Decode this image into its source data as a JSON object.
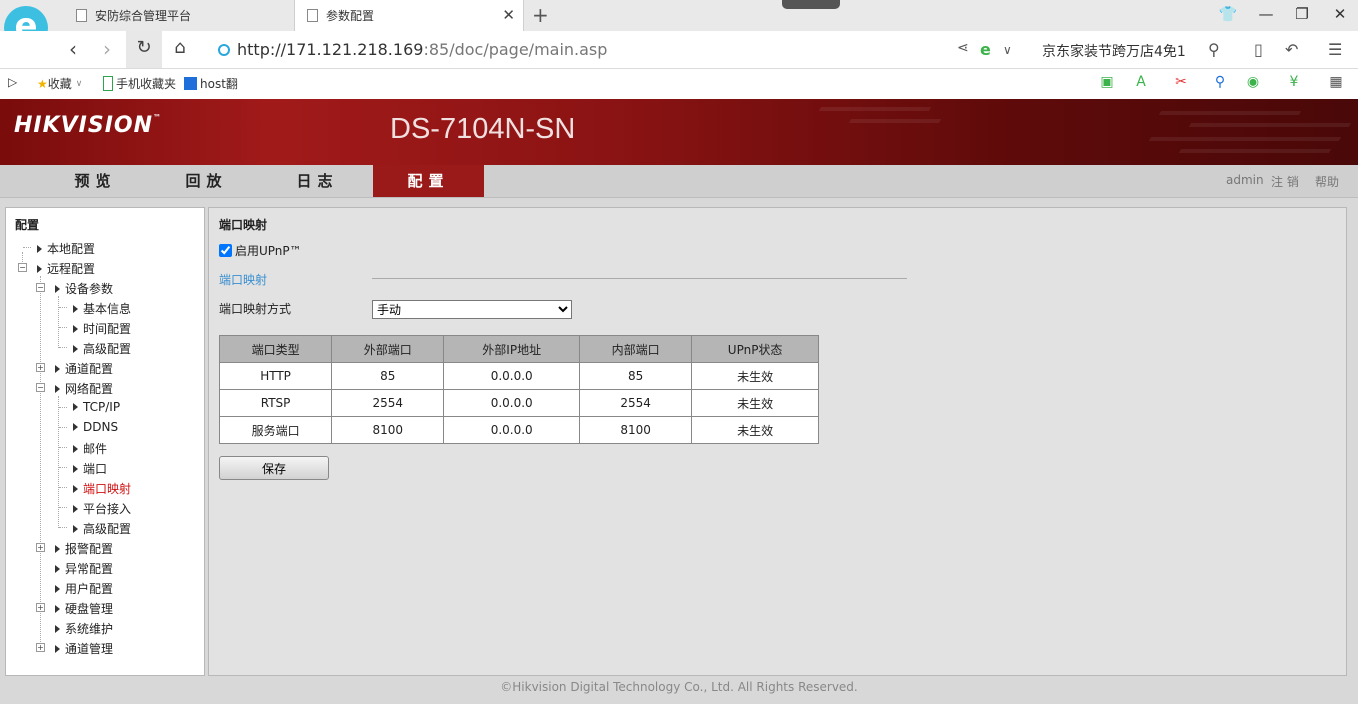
{
  "browser": {
    "tabs": [
      {
        "title": "安防综合管理平台",
        "active": false
      },
      {
        "title": "参数配置",
        "active": true
      }
    ],
    "address": {
      "host": "http://171.121.218.169",
      "rest": ":85/doc/page/main.asp"
    },
    "search_text": "京东家装节跨万店4免1",
    "bookmarks": [
      {
        "label": "收藏",
        "icon": "star-icon"
      },
      {
        "label": "手机收藏夹",
        "icon": "phone-icon"
      },
      {
        "label": "host翻",
        "icon": "bookmark-icon"
      }
    ],
    "logo_glyph": "e"
  },
  "header": {
    "brand": "HIKVISION",
    "model": "DS-7104N-SN"
  },
  "nav": {
    "tabs": [
      {
        "label": "预览",
        "active": false
      },
      {
        "label": "回放",
        "active": false
      },
      {
        "label": "日志",
        "active": false
      },
      {
        "label": "配置",
        "active": true
      }
    ],
    "user": "admin",
    "logout": "注 销",
    "help": "帮助"
  },
  "tree": {
    "title": "配置",
    "nodes": [
      {
        "label": "本地配置"
      },
      {
        "label": "远程配置"
      },
      {
        "label": "设备参数"
      },
      {
        "label": "基本信息"
      },
      {
        "label": "时间配置"
      },
      {
        "label": "高级配置"
      },
      {
        "label": "通道配置"
      },
      {
        "label": "网络配置"
      },
      {
        "label": "TCP/IP"
      },
      {
        "label": "DDNS"
      },
      {
        "label": "邮件"
      },
      {
        "label": "端口"
      },
      {
        "label": "端口映射",
        "selected": true
      },
      {
        "label": "平台接入"
      },
      {
        "label": "高级配置"
      },
      {
        "label": "报警配置"
      },
      {
        "label": "异常配置"
      },
      {
        "label": "用户配置"
      },
      {
        "label": "硬盘管理"
      },
      {
        "label": "系统维护"
      },
      {
        "label": "通道管理"
      }
    ]
  },
  "content": {
    "title": "端口映射",
    "upnp_label": "启用UPnP™",
    "upnp_checked": true,
    "section_label": "端口映射",
    "mode_label": "端口映射方式",
    "mode_value": "手动",
    "table": {
      "headers": [
        "端口类型",
        "外部端口",
        "外部IP地址",
        "内部端口",
        "UPnP状态"
      ],
      "rows": [
        [
          "HTTP",
          "85",
          "0.0.0.0",
          "85",
          "未生效"
        ],
        [
          "RTSP",
          "2554",
          "0.0.0.0",
          "2554",
          "未生效"
        ],
        [
          "服务端口",
          "8100",
          "0.0.0.0",
          "8100",
          "未生效"
        ]
      ]
    },
    "save_label": "保存"
  },
  "footer": "©Hikvision Digital Technology Co., Ltd. All Rights Reserved.",
  "colors": {
    "brand_red": "#9a1a1a",
    "selected_node": "#d01010",
    "link_blue": "#3a8fd0"
  }
}
